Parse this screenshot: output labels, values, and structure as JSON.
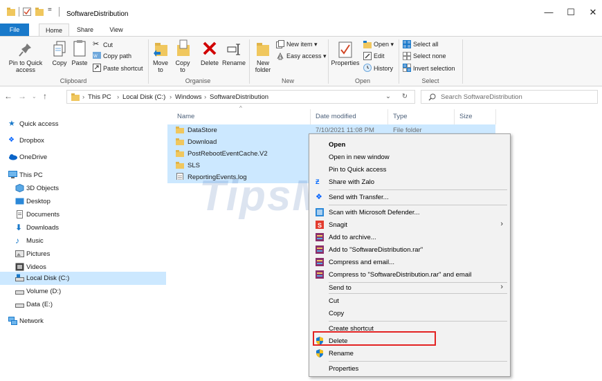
{
  "window": {
    "title": "SoftwareDistribution",
    "qat_dropdown": "=",
    "min": "—",
    "max": "☐",
    "close": "✕"
  },
  "tabs": [
    "File",
    "Home",
    "Share",
    "View"
  ],
  "ribbon": {
    "clipboard": {
      "pin": "Pin to Quick access",
      "copy": "Copy",
      "paste": "Paste",
      "cut": "Cut",
      "copy_path": "Copy path",
      "paste_shortcut": "Paste shortcut",
      "label": "Clipboard"
    },
    "organise": {
      "move_to": "Move to",
      "copy_to": "Copy to",
      "delete": "Delete",
      "rename": "Rename",
      "label": "Organise"
    },
    "new": {
      "new_folder": "New folder",
      "new_item": "New item",
      "easy_access": "Easy access",
      "label": "New"
    },
    "open": {
      "properties": "Properties",
      "open": "Open",
      "edit": "Edit",
      "history": "History",
      "label": "Open"
    },
    "select": {
      "select_all": "Select all",
      "select_none": "Select none",
      "invert": "Invert selection",
      "label": "Select"
    }
  },
  "address": {
    "crumbs": [
      "This PC",
      "Local Disk (C:)",
      "Windows",
      "SoftwareDistribution"
    ],
    "search_placeholder": "Search SoftwareDistribution"
  },
  "nav": {
    "quick_access": "Quick access",
    "dropbox": "Dropbox",
    "onedrive": "OneDrive",
    "this_pc": "This PC",
    "objects3d": "3D Objects",
    "desktop": "Desktop",
    "documents": "Documents",
    "downloads": "Downloads",
    "music": "Music",
    "pictures": "Pictures",
    "videos": "Videos",
    "local_disk": "Local Disk (C:)",
    "volume_d": "Volume (D:)",
    "data_e": "Data (E:)",
    "network": "Network"
  },
  "columns": {
    "name": "Name",
    "date": "Date modified",
    "type": "Type",
    "size": "Size"
  },
  "files": [
    {
      "name": "DataStore",
      "date": "7/10/2021 11:08 PM",
      "type": "File folder"
    },
    {
      "name": "Download",
      "date": "",
      "type": ""
    },
    {
      "name": "PostRebootEventCache.V2",
      "date": "",
      "type": ""
    },
    {
      "name": "SLS",
      "date": "",
      "type": ""
    },
    {
      "name": "ReportingEvents.log",
      "date": "",
      "type": ""
    }
  ],
  "watermark": "TipsMake",
  "menu": {
    "open": "Open",
    "open_new_window": "Open in new window",
    "pin_quick": "Pin to Quick access",
    "share_zalo": "Share with Zalo",
    "send_transfer": "Send with Transfer...",
    "scan_defender": "Scan with Microsoft Defender...",
    "snagit": "Snagit",
    "add_archive": "Add to archive...",
    "add_rar": "Add to \"SoftwareDistribution.rar\"",
    "compress_email": "Compress and email...",
    "compress_rar_email": "Compress to \"SoftwareDistribution.rar\" and email",
    "send_to": "Send to",
    "cut": "Cut",
    "copy": "Copy",
    "create_shortcut": "Create shortcut",
    "delete": "Delete",
    "rename": "Rename",
    "properties": "Properties"
  },
  "colors": {
    "accent": "#1979ca",
    "selection": "#cce8ff",
    "highlight_box": "#e32222",
    "folder": "#f0c75e"
  }
}
